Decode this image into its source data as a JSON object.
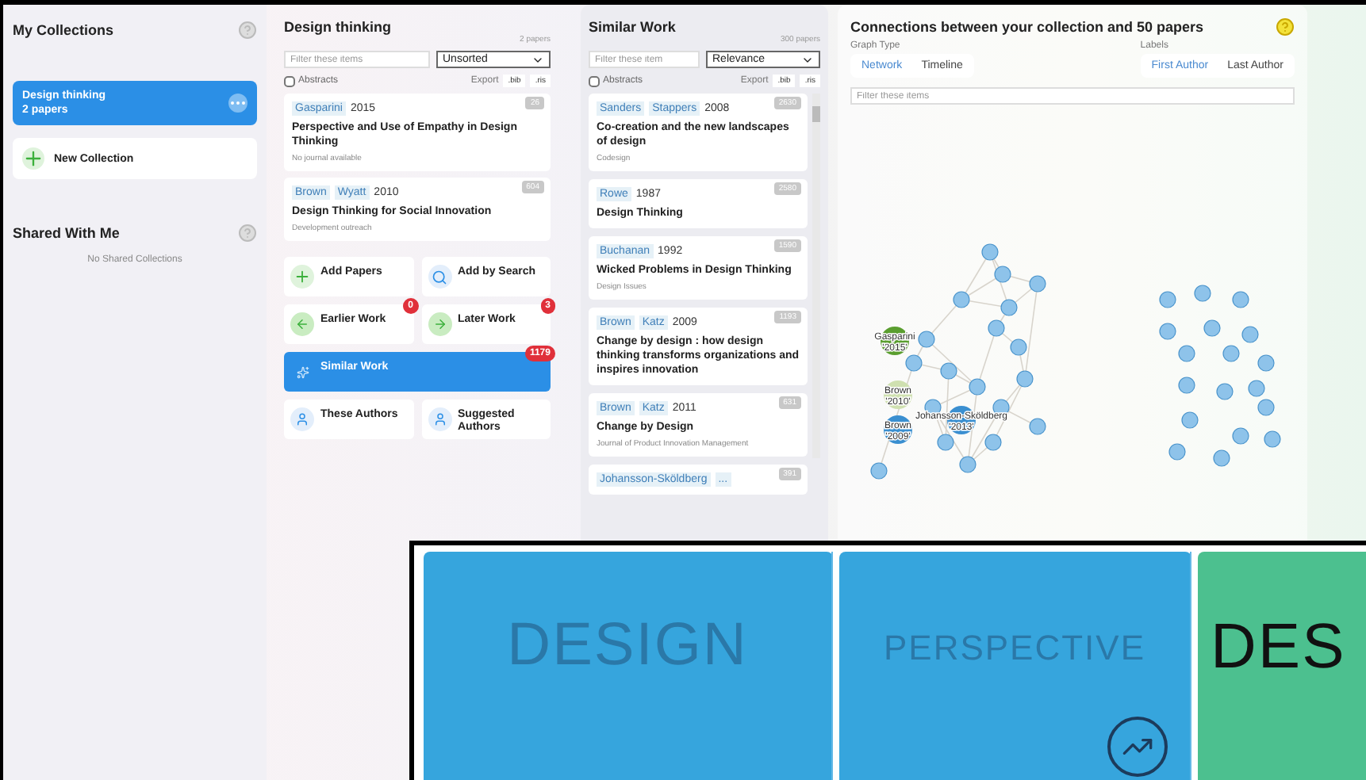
{
  "sidebar": {
    "title": "My Collections",
    "collections": [
      {
        "name": "Design thinking",
        "count": "2 papers",
        "selected": true
      }
    ],
    "new_collection": "New Collection",
    "shared_title": "Shared With Me",
    "shared_empty": "No Shared Collections"
  },
  "collection": {
    "title": "Design thinking",
    "count": "2 papers",
    "filter_placeholder": "Filter these items",
    "sort": "Unsorted",
    "abstracts": {
      "label": "Abstracts",
      "checked": false
    },
    "export_label": "Export",
    "export_formats": [
      ".bib",
      ".ris"
    ],
    "papers": [
      {
        "authors": [
          "Gasparini"
        ],
        "year": "2015",
        "title": "Perspective and Use of Empathy in Design Thinking",
        "journal": "No journal available",
        "citations": "26"
      },
      {
        "authors": [
          "Brown",
          "Wyatt"
        ],
        "year": "2010",
        "title": "Design Thinking for Social Innovation",
        "journal": "Development outreach",
        "citations": "604"
      }
    ],
    "actions": [
      {
        "label": "Add Papers",
        "kind": "plus",
        "selected": false
      },
      {
        "label": "Add by Search",
        "kind": "search",
        "selected": false
      },
      {
        "label": "Earlier Work",
        "kind": "earlier",
        "badge": "0",
        "selected": false
      },
      {
        "label": "Later Work",
        "kind": "later",
        "badge": "3",
        "selected": false
      },
      {
        "label": "Similar Work",
        "kind": "similar",
        "badge": "1179",
        "selected": true
      },
      {
        "label": "These Authors",
        "kind": "authors",
        "selected": false
      },
      {
        "label": "Suggested Authors",
        "kind": "authors",
        "selected": false
      }
    ]
  },
  "similar": {
    "title": "Similar Work",
    "count": "300 papers",
    "filter_placeholder": "Filter these item",
    "sort": "Relevance",
    "abstracts": {
      "label": "Abstracts",
      "checked": false
    },
    "export_label": "Export",
    "export_formats": [
      ".bib",
      ".ris"
    ],
    "papers": [
      {
        "authors": [
          "Sanders",
          "Stappers"
        ],
        "year": "2008",
        "title": "Co-creation and the new landscapes of design",
        "journal": "Codesign",
        "citations": "2630"
      },
      {
        "authors": [
          "Rowe"
        ],
        "year": "1987",
        "title": "Design Thinking",
        "citations": "2580"
      },
      {
        "authors": [
          "Buchanan"
        ],
        "year": "1992",
        "title": "Wicked Problems in Design Thinking",
        "journal": "Design Issues",
        "citations": "1590"
      },
      {
        "authors": [
          "Brown",
          "Katz"
        ],
        "year": "2009",
        "title": "Change by design : how design thinking transforms organizations and inspires innovation",
        "citations": "1193"
      },
      {
        "authors": [
          "Brown",
          "Katz"
        ],
        "year": "2011",
        "title": "Change by Design",
        "journal": "Journal of Product Innovation Management",
        "citations": "631"
      },
      {
        "authors": [
          "Johansson-Sköldberg",
          "..."
        ],
        "citations": "391"
      }
    ]
  },
  "graph": {
    "title": "Connections between your collection and 50 papers",
    "graph_type_label": "Graph Type",
    "graph_types": [
      {
        "label": "Network",
        "selected": true
      },
      {
        "label": "Timeline",
        "selected": false
      }
    ],
    "labels_label": "Labels",
    "label_modes": [
      {
        "label": "First Author",
        "selected": true
      },
      {
        "label": "Last Author",
        "selected": false
      }
    ],
    "filter_placeholder": "Filter these items",
    "labeled_nodes": [
      {
        "name": "Gasparini",
        "year": "'2015'",
        "color": "#5a9e2f"
      },
      {
        "name": "Brown",
        "year": "'2010'",
        "color": "#cfe0b0"
      },
      {
        "name": "Johansson-Sköldberg",
        "year": "'2013'",
        "color": "#3a8fd0"
      },
      {
        "name": "Brown",
        "year": "'2009'",
        "color": "#3a8fd0"
      }
    ]
  },
  "overlay": {
    "panels": [
      {
        "kind": "blue",
        "text": "DESIGN"
      },
      {
        "kind": "blue",
        "text": "PERSPECTIVE"
      },
      {
        "kind": "green",
        "text": "DES"
      }
    ]
  }
}
